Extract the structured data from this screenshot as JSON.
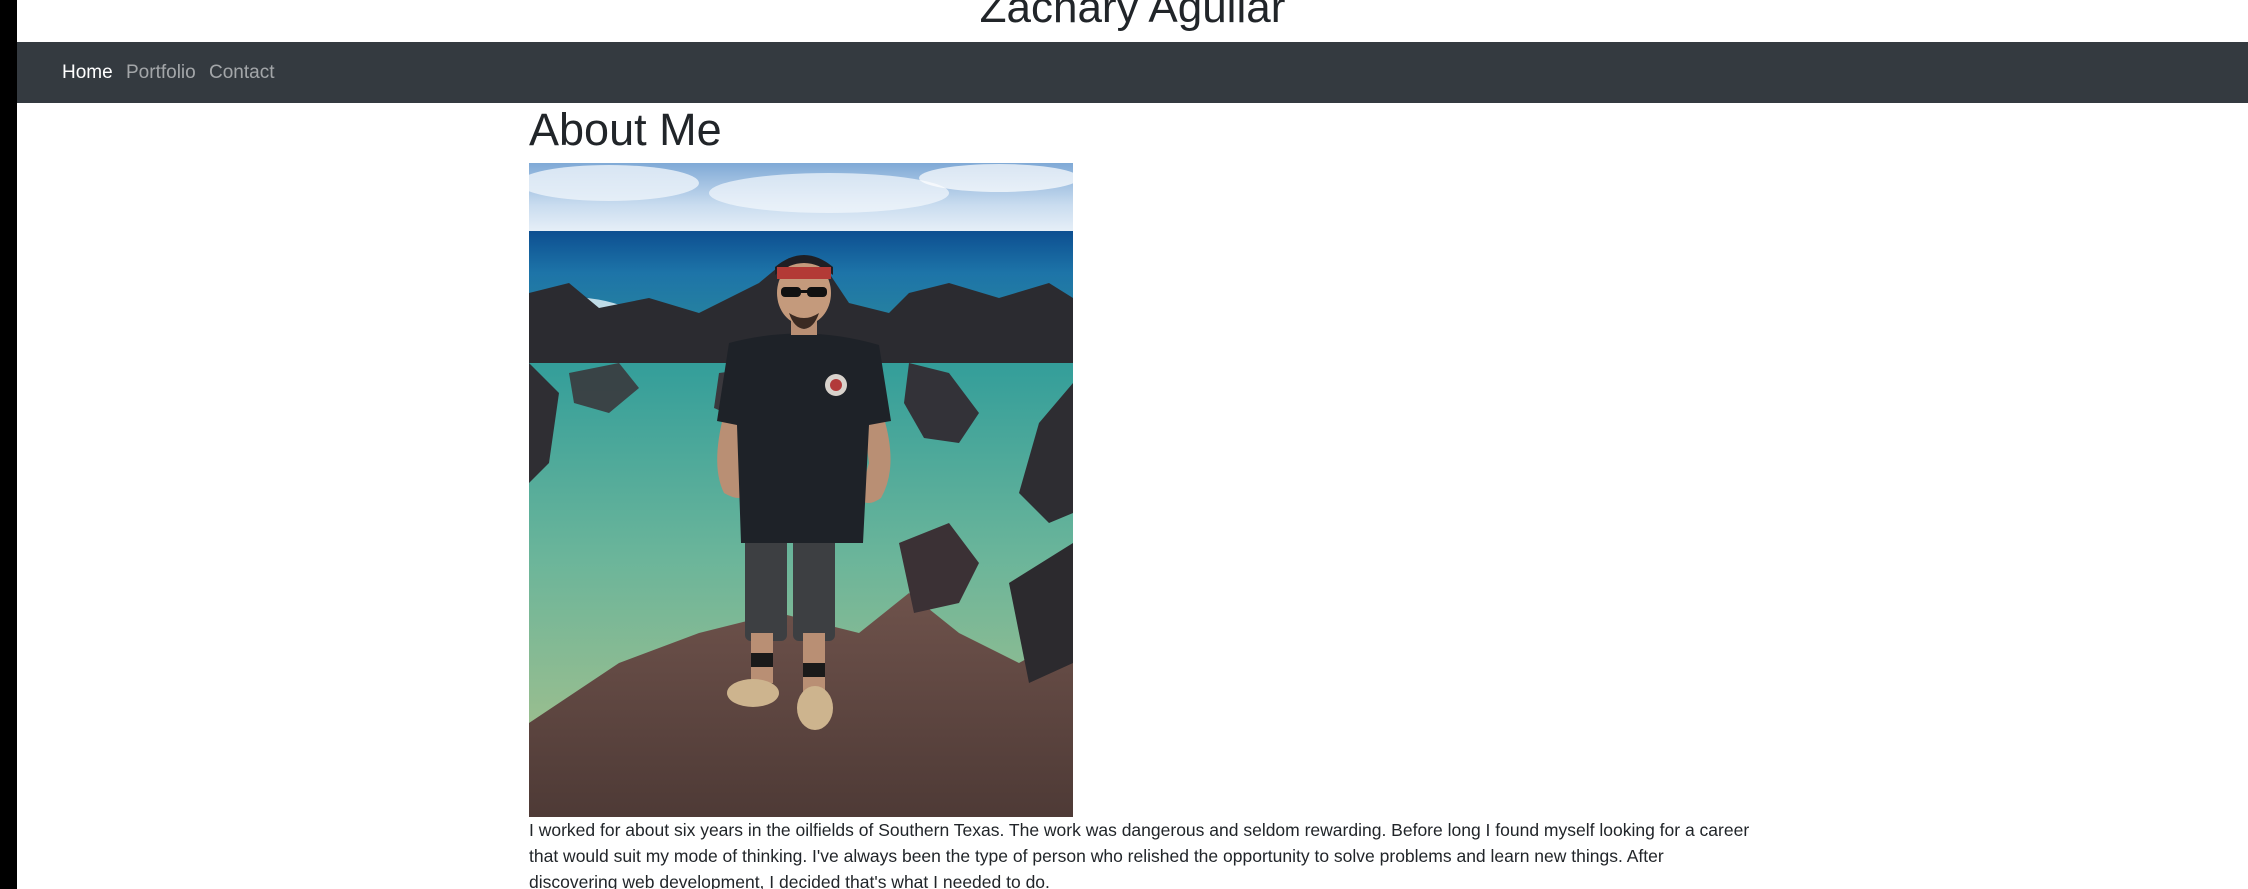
{
  "header": {
    "site_title": "Zachary Aguilar"
  },
  "nav": {
    "items": [
      {
        "label": "Home",
        "active": true
      },
      {
        "label": "Portfolio",
        "active": false
      },
      {
        "label": "Contact",
        "active": false
      }
    ]
  },
  "main": {
    "heading": "About Me",
    "bio": "I worked for about six years in the oilfields of Southern Texas. The work was dangerous and seldom rewarding. Before long I found myself looking for a career that would suit my mode of thinking. I've always been the type of person who relished the opportunity to solve problems and learn new things. After discovering web development, I decided that's what I needed to do."
  },
  "colors": {
    "navbar_bg": "#343a40",
    "nav_active": "#ffffff",
    "nav_inactive": "rgba(255,255,255,0.55)",
    "text": "#212529"
  }
}
